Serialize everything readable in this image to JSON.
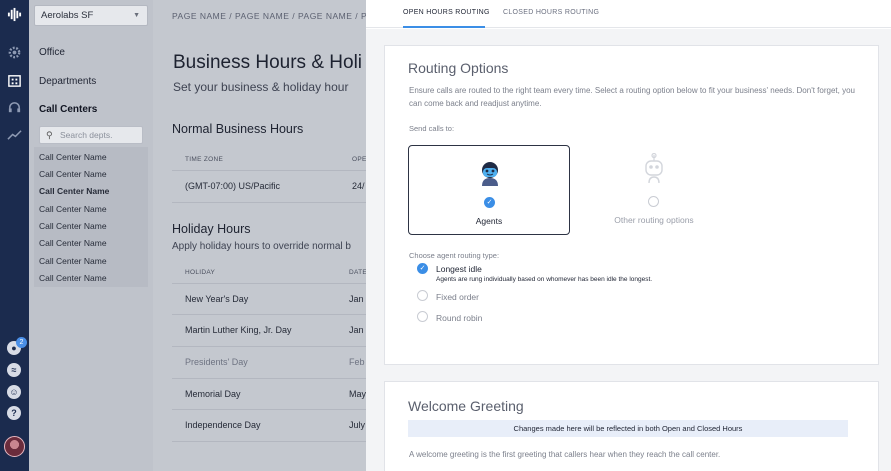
{
  "rail": {
    "icons": [
      "logo-icon",
      "gear-icon",
      "building-icon",
      "headset-icon",
      "trend-icon",
      "bell-icon",
      "wave-icon",
      "face-icon",
      "help-icon"
    ],
    "badge": "2"
  },
  "leftnav": {
    "workspace": "Aerolabs SF",
    "items": [
      "Office",
      "Departments",
      "Call Centers"
    ],
    "search_placeholder": "Search depts.",
    "call_centers": [
      "Call Center Name",
      "Call Center Name",
      "Call Center Name",
      "Call Center Name",
      "Call Center Name",
      "Call Center Name",
      "Call Center Name",
      "Call Center Name"
    ]
  },
  "main": {
    "breadcrumb": "PAGE NAME  /  PAGE NAME  /  PAGE NAME  /  PAG",
    "title": "Business Hours & Holi",
    "subtitle": "Set your business & holiday hour",
    "normal": {
      "heading": "Normal Business Hours",
      "col1": "TIME ZONE",
      "col2": "OPE",
      "tz": "(GMT-07:00) US/Pacific",
      "hours": "24/"
    },
    "holiday": {
      "heading": "Holiday Hours",
      "desc": "Apply holiday hours to override normal b",
      "col1": "HOLIDAY",
      "col2": "DATE",
      "rows": [
        {
          "name": "New Year's Day",
          "date": "Jan"
        },
        {
          "name": "Martin Luther King, Jr. Day",
          "date": "Jan"
        },
        {
          "name": "Presidents' Day",
          "date": "Feb"
        },
        {
          "name": "Memorial Day",
          "date": "May"
        },
        {
          "name": "Independence Day",
          "date": "July"
        }
      ]
    }
  },
  "panel": {
    "tabs": [
      "OPEN HOURS ROUTING",
      "CLOSED HOURS ROUTING"
    ],
    "routing": {
      "title": "Routing Options",
      "desc": "Ensure calls are routed to the right team every time. Select a routing option below to fit your business' needs. Don't forget, you can come back and readjust anytime.",
      "send_to": "Send calls to:",
      "agents": "Agents",
      "other": "Other routing options",
      "choose": "Choose agent routing type:",
      "types": [
        "Longest idle",
        "Fixed order",
        "Round robin"
      ],
      "longest_desc": "Agents are rung individually based on whomever has been idle the longest."
    },
    "welcome": {
      "title": "Welcome Greeting",
      "notice": "Changes made here will be reflected in both Open and Closed Hours",
      "desc": "A welcome greeting is the first greeting that callers hear when they reach the call center."
    }
  }
}
